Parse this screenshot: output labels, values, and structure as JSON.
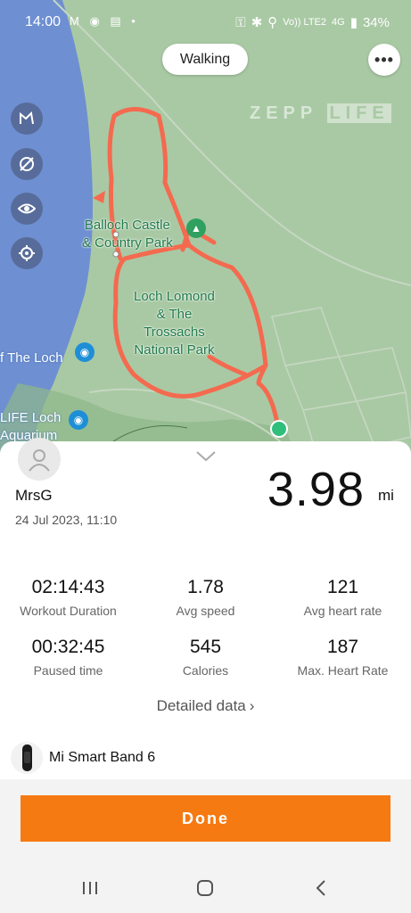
{
  "status_bar": {
    "time": "14:00",
    "left_icons": "M ◉ ▤ •",
    "network": "Vo)) LTE2",
    "signal": "4G",
    "battery": "34%"
  },
  "map": {
    "activity_label": "Walking",
    "watermark_a": "ZEPP",
    "watermark_b": "LIFE",
    "labels": {
      "balloch": "Balloch Castle\n& Country Park",
      "loch_lomond": "Loch Lomond\n& The\nTrossachs\nNational Park",
      "the_loch": "f The Loch",
      "life_loch": "LIFE Loch\nAquarium"
    },
    "route_color": "#f46a4f",
    "end_marker_color": "#2fbf7a"
  },
  "summary": {
    "user_name": "MrsG",
    "date": "24 Jul 2023, 11:10",
    "distance": "3.98",
    "unit": "mi"
  },
  "stats": [
    {
      "value": "02:14:43",
      "label": "Workout Duration"
    },
    {
      "value": "1.78",
      "label": "Avg speed"
    },
    {
      "value": "121",
      "label": "Avg heart rate"
    },
    {
      "value": "00:32:45",
      "label": "Paused time"
    },
    {
      "value": "545",
      "label": "Calories"
    },
    {
      "value": "187",
      "label": "Max. Heart Rate"
    }
  ],
  "detailed_link": "Detailed data",
  "device": {
    "name": "Mi Smart Band 6"
  },
  "done_label": "Done",
  "colors": {
    "accent": "#f67a12",
    "water": "#6e8fd1",
    "land": "#a9c9a4"
  }
}
